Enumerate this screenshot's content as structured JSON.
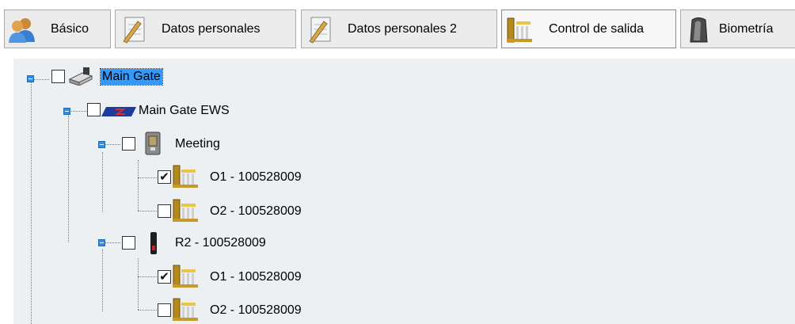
{
  "tabs": [
    {
      "label": "Básico",
      "icon": "users-icon"
    },
    {
      "label": "Datos personales",
      "icon": "notepad-icon"
    },
    {
      "label": "Datos personales 2",
      "icon": "notepad-icon"
    },
    {
      "label": "Control de salida",
      "icon": "gate-icon",
      "active": true
    },
    {
      "label": "Biometría",
      "icon": "fingerprint-reader-icon"
    }
  ],
  "tree": {
    "root": {
      "label": "Main Gate",
      "checked": false,
      "selected": true,
      "icon": "server-gate-icon"
    },
    "panel": {
      "label": "Main Gate EWS",
      "checked": false,
      "icon": "ews-panel-icon"
    },
    "readers": [
      {
        "label": "Meeting",
        "checked": false,
        "icon": "door-reader-icon",
        "outputs": [
          {
            "label": "O1 - 100528009",
            "checked": true,
            "icon": "gate-output-icon"
          },
          {
            "label": "O2 - 100528009",
            "checked": false,
            "icon": "gate-output-icon"
          }
        ]
      },
      {
        "label": "R2 - 100528009",
        "checked": false,
        "icon": "slim-reader-icon",
        "outputs": [
          {
            "label": "O1 - 100528009",
            "checked": true,
            "icon": "gate-output-icon"
          },
          {
            "label": "O2 - 100528009",
            "checked": false,
            "icon": "gate-output-icon"
          }
        ]
      }
    ]
  },
  "colors": {
    "selection": "#3399ff",
    "expander": "#2f8fe0",
    "tree_background": "#edf0f3"
  }
}
